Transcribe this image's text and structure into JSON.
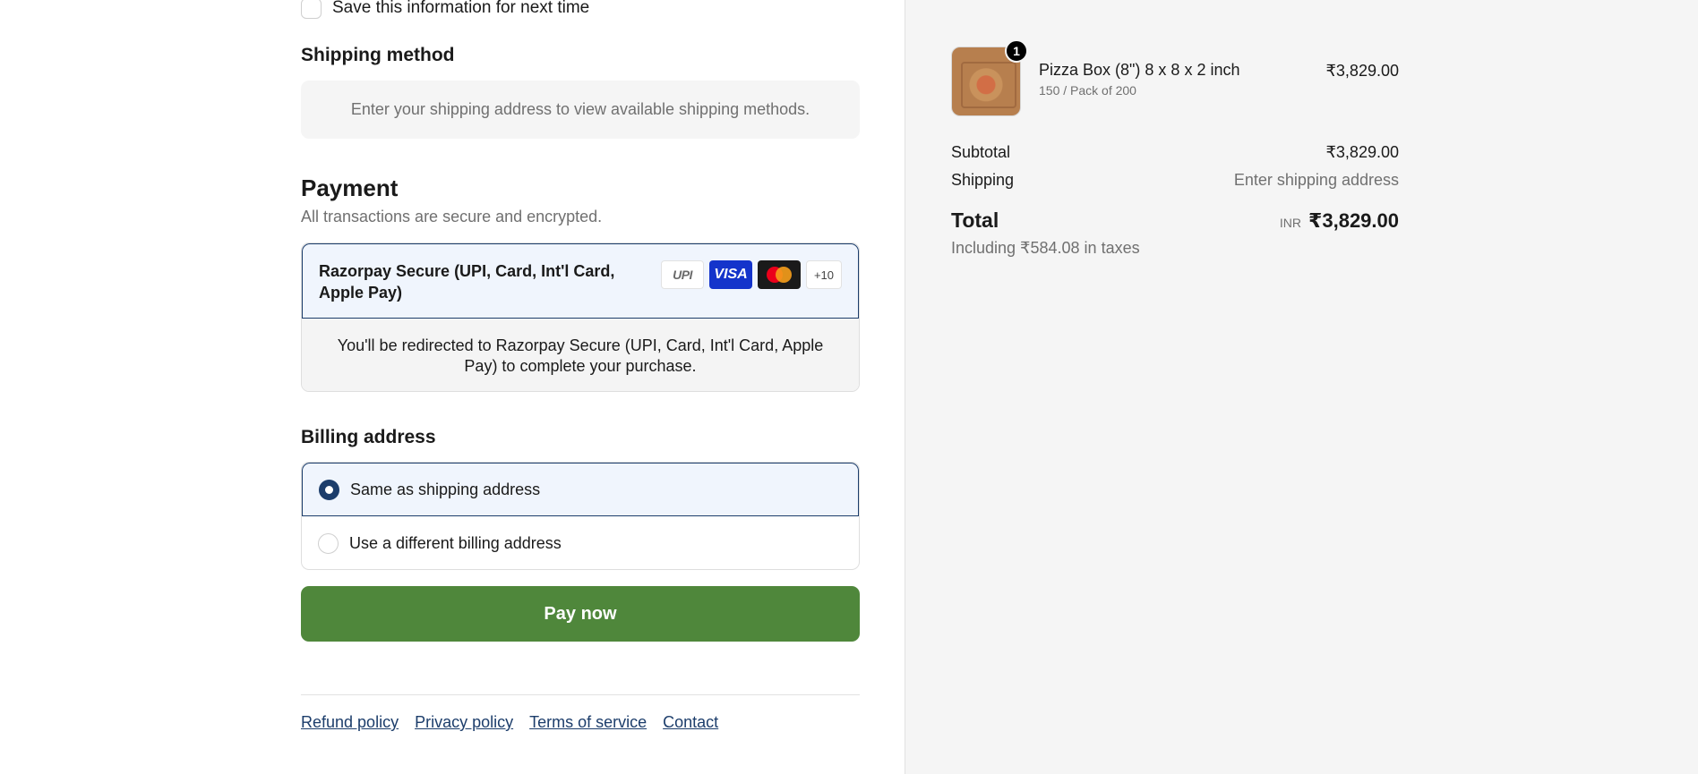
{
  "contact": {
    "save_info_label": "Save this information for next time"
  },
  "shipping_method": {
    "title": "Shipping method",
    "placeholder_text": "Enter your shipping address to view available shipping methods."
  },
  "payment": {
    "title": "Payment",
    "subtitle": "All transactions are secure and encrypted.",
    "option_label": "Razorpay Secure (UPI, Card, Int'l Card, Apple Pay)",
    "logos": [
      "UPI",
      "VISA",
      "mastercard",
      "+10"
    ],
    "redirect_text": "You'll be redirected to Razorpay Secure (UPI, Card, Int'l Card, Apple Pay) to complete your purchase."
  },
  "billing": {
    "title": "Billing address",
    "options": [
      {
        "label": "Same as shipping address",
        "selected": true
      },
      {
        "label": "Use a different billing address",
        "selected": false
      }
    ]
  },
  "pay_button_label": "Pay now",
  "footer_links": [
    "Refund policy",
    "Privacy policy",
    "Terms of service",
    "Contact"
  ],
  "summary": {
    "item": {
      "name": "Pizza Box (8\") 8 x 8 x 2 inch",
      "variant": "150 / Pack of 200",
      "price": "₹3,829.00",
      "quantity": "1"
    },
    "subtotal_label": "Subtotal",
    "subtotal_value": "₹3,829.00",
    "shipping_label": "Shipping",
    "shipping_value": "Enter shipping address",
    "total_label": "Total",
    "currency": "INR",
    "total_value": "₹3,829.00",
    "taxes_text": "Including ₹584.08 in taxes"
  },
  "colors": {
    "accent": "#1c3d6b",
    "pay_button": "#4f873b",
    "summary_bg": "#f5f5f5"
  }
}
